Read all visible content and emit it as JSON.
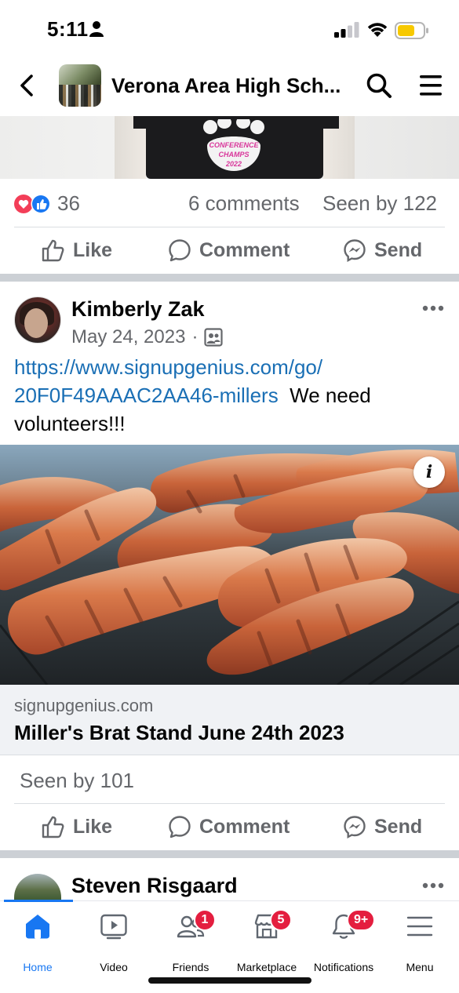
{
  "status_bar": {
    "time": "5:11"
  },
  "top_nav": {
    "group_title": "Verona Area High Sch..."
  },
  "previous_post": {
    "shirt_text": [
      "CONFERENCE",
      "CHAMPS",
      "2022"
    ],
    "reaction_count": "36",
    "comments": "6 comments",
    "seen_by": "Seen by 122"
  },
  "actions": {
    "like": "Like",
    "comment": "Comment",
    "send": "Send"
  },
  "post": {
    "author": "Kimberly Zak",
    "date": "May 24, 2023",
    "date_separator": "·",
    "link_line1": "https://www.signupgenius.com/go/",
    "link_line2": "20F0F49AAAC2AA46-millers",
    "text_after_link": "We need",
    "text_line3": "volunteers!!!",
    "link_card": {
      "domain": "signupgenius.com",
      "title": "Miller's Brat Stand June 24th 2023"
    },
    "info_glyph": "i",
    "seen_by": "Seen by 101"
  },
  "next_post": {
    "author": "Steven Risgaard"
  },
  "tabbar": {
    "tabs": [
      {
        "label": "Home",
        "badge": ""
      },
      {
        "label": "Video",
        "badge": ""
      },
      {
        "label": "Friends",
        "badge": "1"
      },
      {
        "label": "Marketplace",
        "badge": "5"
      },
      {
        "label": "Notifications",
        "badge": "9+"
      },
      {
        "label": "Menu",
        "badge": ""
      }
    ]
  },
  "colors": {
    "accent": "#1877f2",
    "link": "#1a6fb5",
    "badge": "#e41e3f",
    "battery": "#f7c900"
  }
}
